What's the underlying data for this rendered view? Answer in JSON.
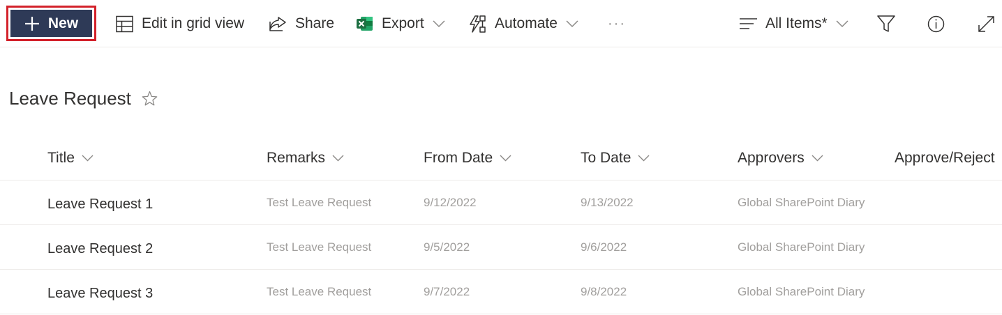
{
  "toolbar": {
    "new_label": "New",
    "edit_grid_label": "Edit in grid view",
    "share_label": "Share",
    "export_label": "Export",
    "automate_label": "Automate",
    "more_label": "···",
    "view_label": "All Items*"
  },
  "list": {
    "title": "Leave Request",
    "columns": [
      "Title",
      "Remarks",
      "From Date",
      "To Date",
      "Approvers",
      "Approve/Reject"
    ],
    "rows": [
      {
        "title": "Leave Request 1",
        "remarks": "Test Leave Request",
        "from": "9/12/2022",
        "to": "9/13/2022",
        "approvers": "Global SharePoint Diary"
      },
      {
        "title": "Leave Request 2",
        "remarks": "Test Leave Request",
        "from": "9/5/2022",
        "to": "9/6/2022",
        "approvers": "Global SharePoint Diary"
      },
      {
        "title": "Leave Request 3",
        "remarks": "Test Leave Request",
        "from": "9/7/2022",
        "to": "9/8/2022",
        "approvers": "Global SharePoint Diary"
      }
    ]
  },
  "colors": {
    "new_button_bg": "#2e3a57",
    "highlight_border": "#d3212a",
    "excel_green": "#1d6f42",
    "text": "#323130",
    "muted_text": "#a19f9d",
    "divider": "#edebe9"
  },
  "icons": {
    "new": "plus-icon",
    "edit_grid": "grid-icon",
    "share": "share-icon",
    "export": "excel-icon",
    "automate": "automate-icon",
    "view": "lines-icon",
    "filter": "filter-icon",
    "info": "info-icon",
    "expand": "expand-icon",
    "favorite": "star-icon",
    "sort": "chevron-down-icon"
  }
}
